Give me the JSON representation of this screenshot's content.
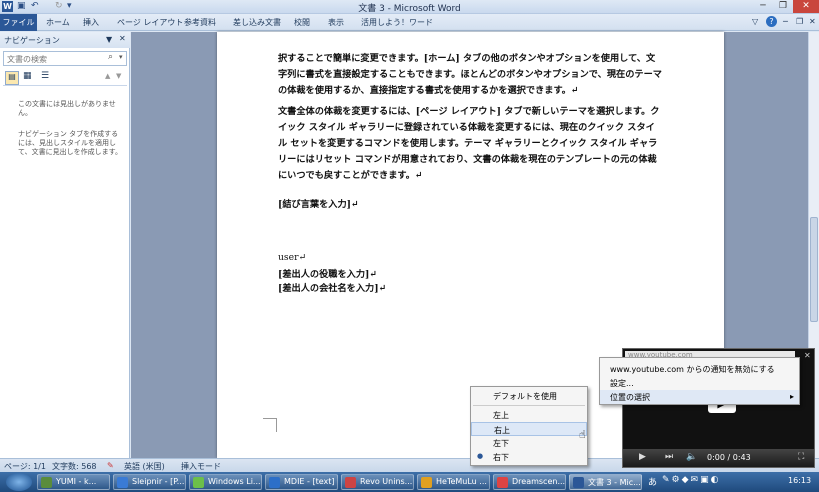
{
  "window": {
    "title": "文書 3 - Microsoft Word"
  },
  "ribbon": {
    "tabs": [
      "ファイル",
      "ホーム",
      "挿入",
      "ページ レイアウト",
      "参考資料",
      "差し込み文書",
      "校閲",
      "表示",
      "活用しよう！ワード"
    ]
  },
  "nav": {
    "title": "ナビゲーション",
    "search_placeholder": "文書の検索",
    "msg1": "この文書には見出しがありません。",
    "msg2": "ナビゲーション タブを作成するには、見出しスタイルを適用して、文書に見出しを作成します。"
  },
  "doc": {
    "p1": "択することで簡単に変更できます。[ホーム] タブの他のボタンやオプションを使用して、文字列に書式を直接設定することもできます。ほとんどのボタンやオプションで、現在のテーマの体裁を使用するか、直接指定する書式を使用するかを選択できます。↵",
    "p2": "文書全体の体裁を変更するには、[ページ レイアウト] タブで新しいテーマを選択します。クイック スタイル ギャラリーに登録されている体裁を変更するには、現在のクイック スタイル セットを変更するコマンドを使用します。テーマ ギャラリーとクイック スタイル ギャラリーにはリセット コマンドが用意されており、文書の体裁を現在のテンプレートの元の体裁にいつでも戻すことができます。↵",
    "closing": "[結び言葉を入力]↵",
    "user": "user↵",
    "title_ph": "[差出人の役職を入力]↵",
    "company_ph": "[差出人の会社名を入力]↵"
  },
  "status": {
    "page": "ページ: 1/1",
    "words": "文字数: 568",
    "lang": "英語 (米国)",
    "mode": "挿入モード"
  },
  "menu_notify": {
    "url": "www.youtube.com",
    "items": [
      "www.youtube.com からの通知を無効にする",
      "設定...",
      "位置の選択"
    ]
  },
  "menu_position": {
    "items": [
      "デフォルトを使用",
      "左上",
      "右上",
      "左下",
      "右下"
    ],
    "selected": "右下"
  },
  "video": {
    "time": "0:00 / 0:43"
  },
  "taskbar": {
    "items": [
      "YUMI - k...",
      "Sleipnir - [P...",
      "Windows Li...",
      "MDIE - [text]",
      "Revo Unins...",
      "HeTeMuLu ...",
      "Dreamscen...",
      "文書 3 - Mic..."
    ],
    "clock": "16:13"
  },
  "colors": {
    "file_tab": "#2b5797",
    "page": "#ffffff",
    "workspace": "#8a9ab4"
  }
}
